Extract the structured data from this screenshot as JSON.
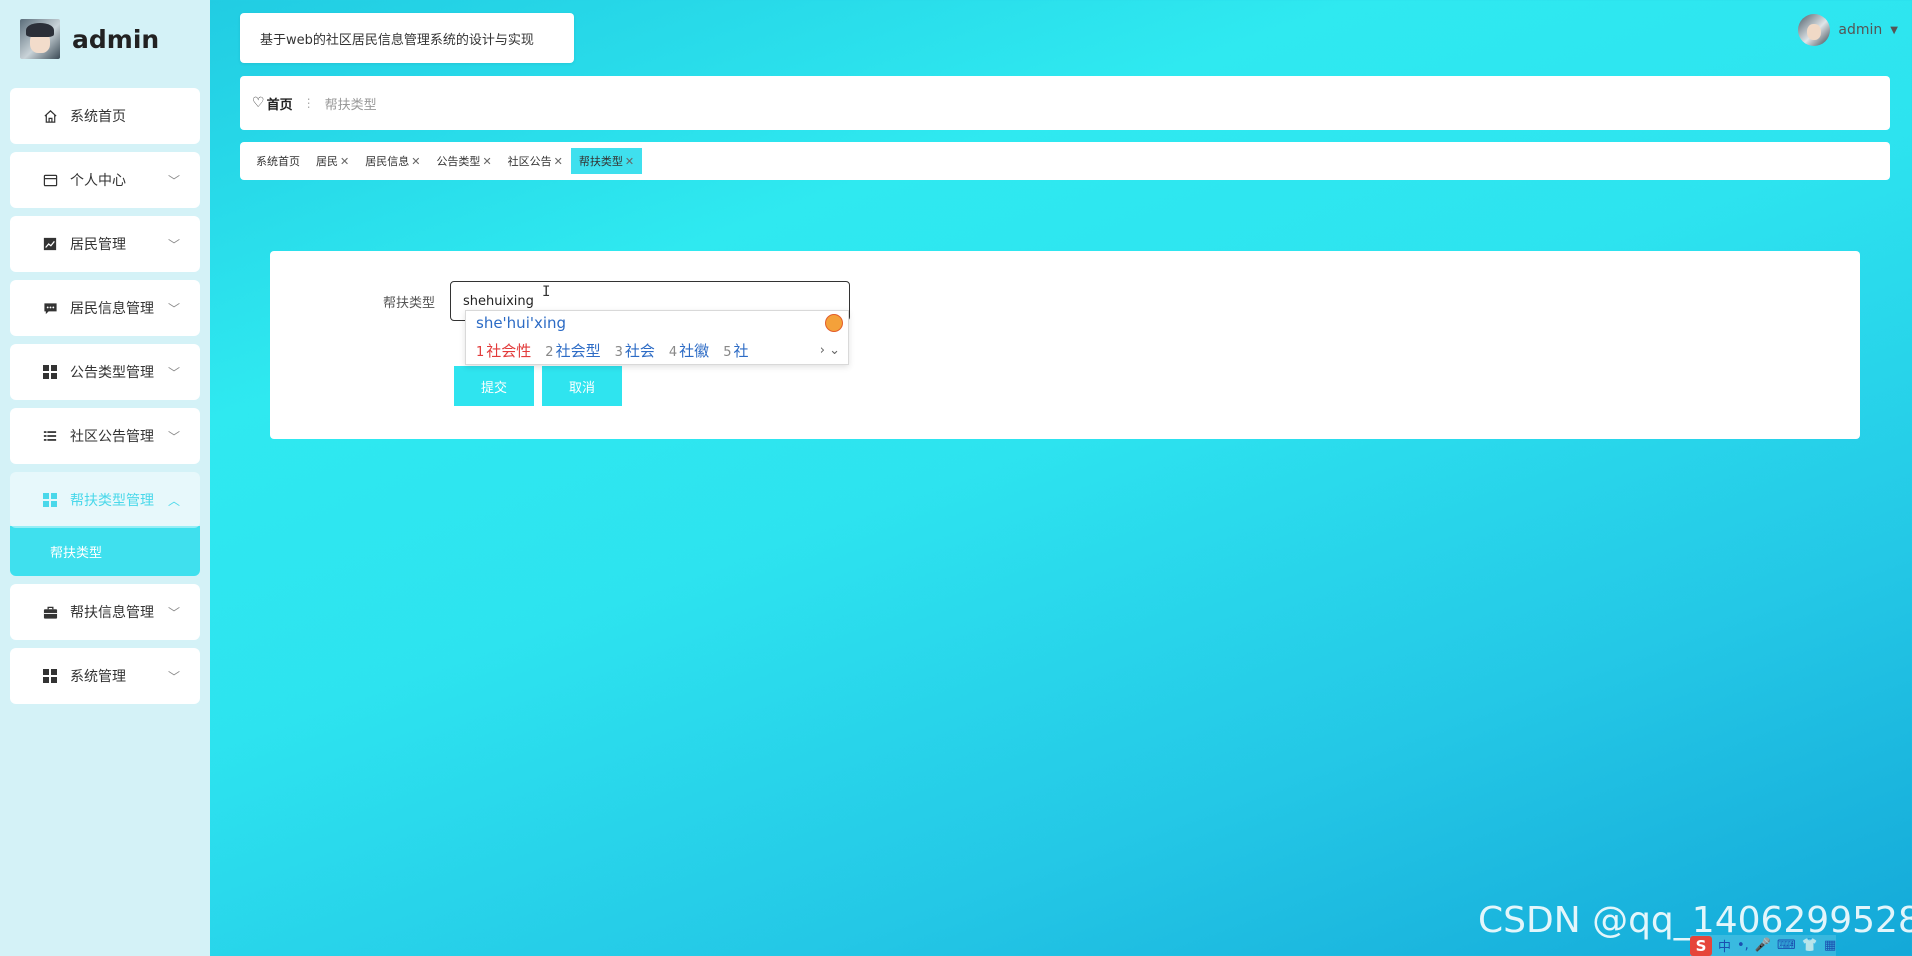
{
  "brand": {
    "name": "admin"
  },
  "sidebar": {
    "items": [
      {
        "label": "系统首页",
        "icon": "home-icon",
        "chevron": false
      },
      {
        "label": "个人中心",
        "icon": "user-card-icon",
        "chevron": true
      },
      {
        "label": "居民管理",
        "icon": "chart-icon",
        "chevron": true
      },
      {
        "label": "居民信息管理",
        "icon": "message-icon",
        "chevron": true
      },
      {
        "label": "公告类型管理",
        "icon": "grid-icon",
        "chevron": true
      },
      {
        "label": "社区公告管理",
        "icon": "list-icon",
        "chevron": true
      },
      {
        "label": "帮扶类型管理",
        "icon": "grid-icon",
        "chevron": true,
        "expanded": true
      },
      {
        "label": "帮扶信息管理",
        "icon": "briefcase-icon",
        "chevron": true
      },
      {
        "label": "系统管理",
        "icon": "grid-icon",
        "chevron": true
      }
    ],
    "submenu": {
      "label": "帮扶类型"
    }
  },
  "header": {
    "title": "基于web的社区居民信息管理系统的设计与实现",
    "user": "admin"
  },
  "breadcrumb": {
    "home": "首页",
    "current": "帮扶类型"
  },
  "tabs": [
    {
      "label": "系统首页",
      "closable": false
    },
    {
      "label": "居民",
      "closable": true
    },
    {
      "label": "居民信息",
      "closable": true
    },
    {
      "label": "公告类型",
      "closable": true
    },
    {
      "label": "社区公告",
      "closable": true
    },
    {
      "label": "帮扶类型",
      "closable": true,
      "active": true
    }
  ],
  "form": {
    "label": "帮扶类型",
    "value": "shehuixing",
    "submit": "提交",
    "cancel": "取消"
  },
  "ime": {
    "pinyin": "she'hui'xing",
    "candidates": [
      {
        "num": "1",
        "text": "社会性"
      },
      {
        "num": "2",
        "text": "社会型"
      },
      {
        "num": "3",
        "text": "社会"
      },
      {
        "num": "4",
        "text": "社徽"
      },
      {
        "num": "5",
        "text": "社"
      }
    ]
  },
  "watermark": "CSDN @qq_1406299528",
  "tray": {
    "lang": "中"
  },
  "colors": {
    "accent": "#3fe0ee",
    "background": "#2de3ef",
    "sidebar": "#d4f2f7"
  }
}
